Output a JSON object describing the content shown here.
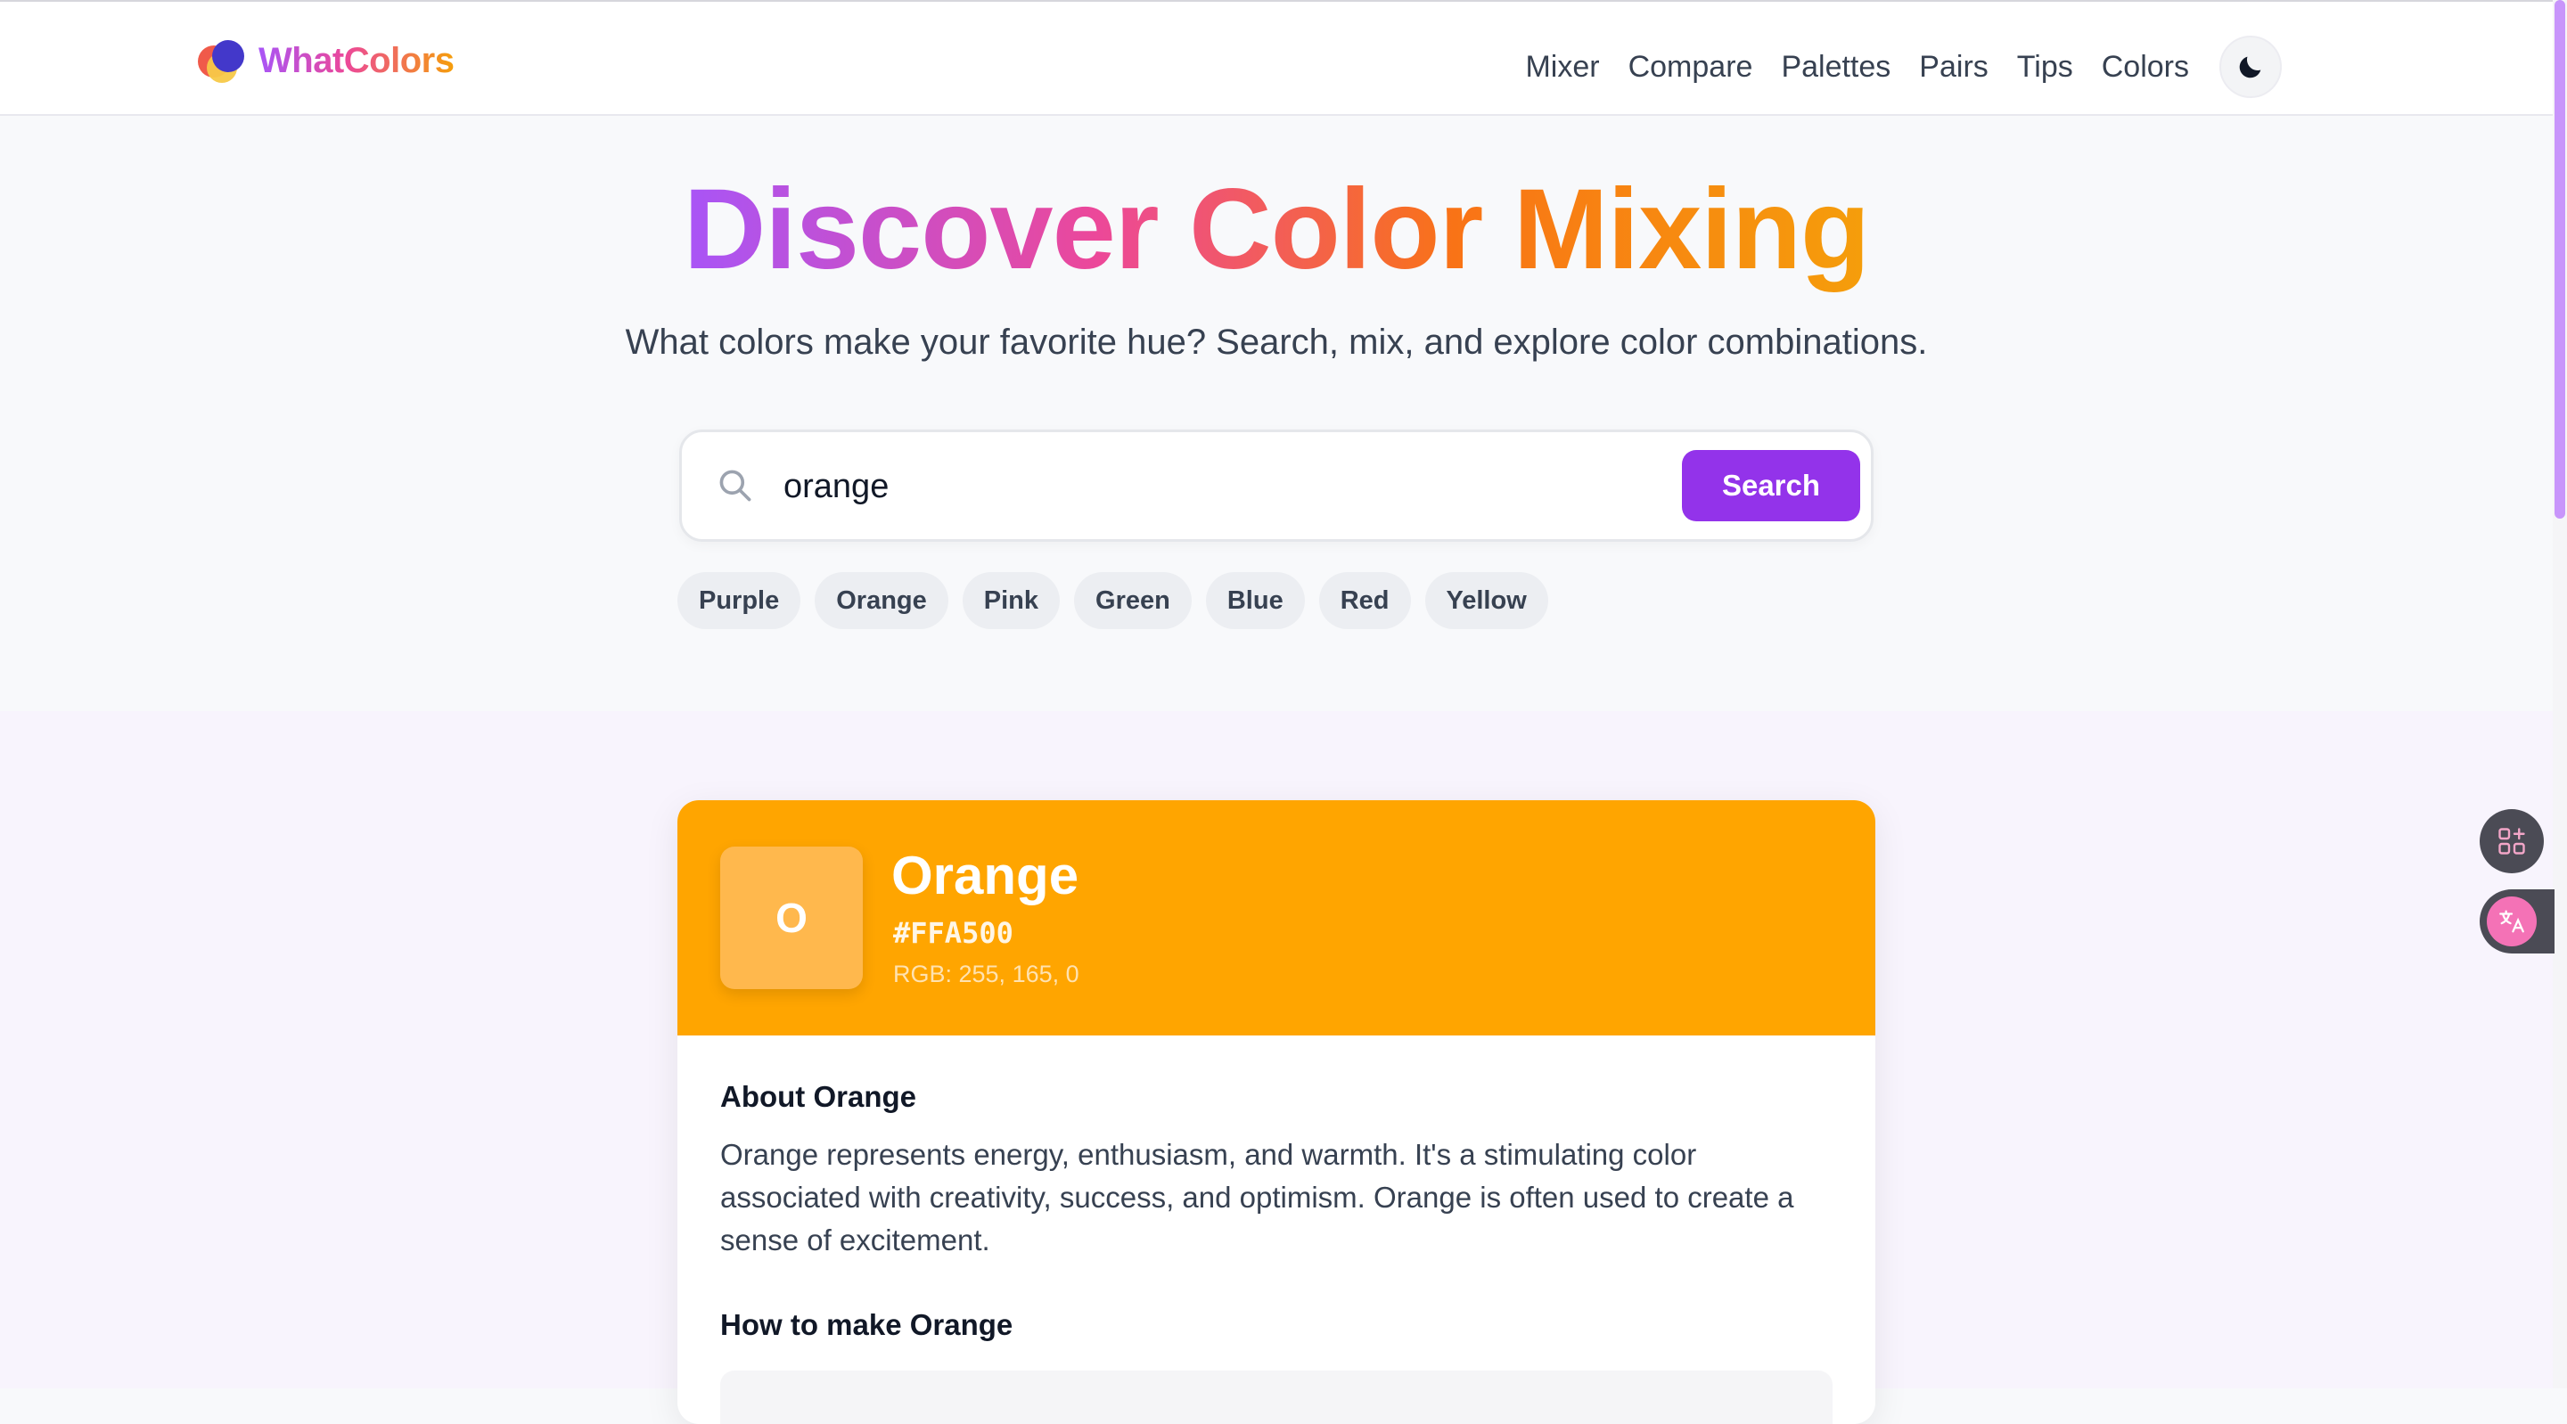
{
  "header": {
    "logo_text": "WhatColors",
    "nav": [
      "Mixer",
      "Compare",
      "Palettes",
      "Pairs",
      "Tips",
      "Colors"
    ],
    "theme_icon": "moon-icon"
  },
  "hero": {
    "title": "Discover Color Mixing",
    "subtitle": "What colors make your favorite hue? Search, mix, and explore color combinations.",
    "search": {
      "value": "orange",
      "button_label": "Search",
      "icon": "search-icon"
    },
    "chips": [
      "Purple",
      "Orange",
      "Pink",
      "Green",
      "Blue",
      "Red",
      "Yellow"
    ]
  },
  "color_card": {
    "swatch_letter": "O",
    "name": "Orange",
    "hex": "#FFA500",
    "rgb": "RGB: 255, 165, 0",
    "about_title": "About Orange",
    "about_text": "Orange represents energy, enthusiasm, and warmth. It's a stimulating color associated with creativity, success, and optimism. Orange is often used to create a sense of excitement.",
    "howto_title": "How to make Orange"
  },
  "colors": {
    "accent": "#9333ea",
    "card_header": "#ffa500",
    "swatch": "#ffb84d"
  },
  "side_buttons": [
    "apps-icon",
    "translate-icon"
  ]
}
